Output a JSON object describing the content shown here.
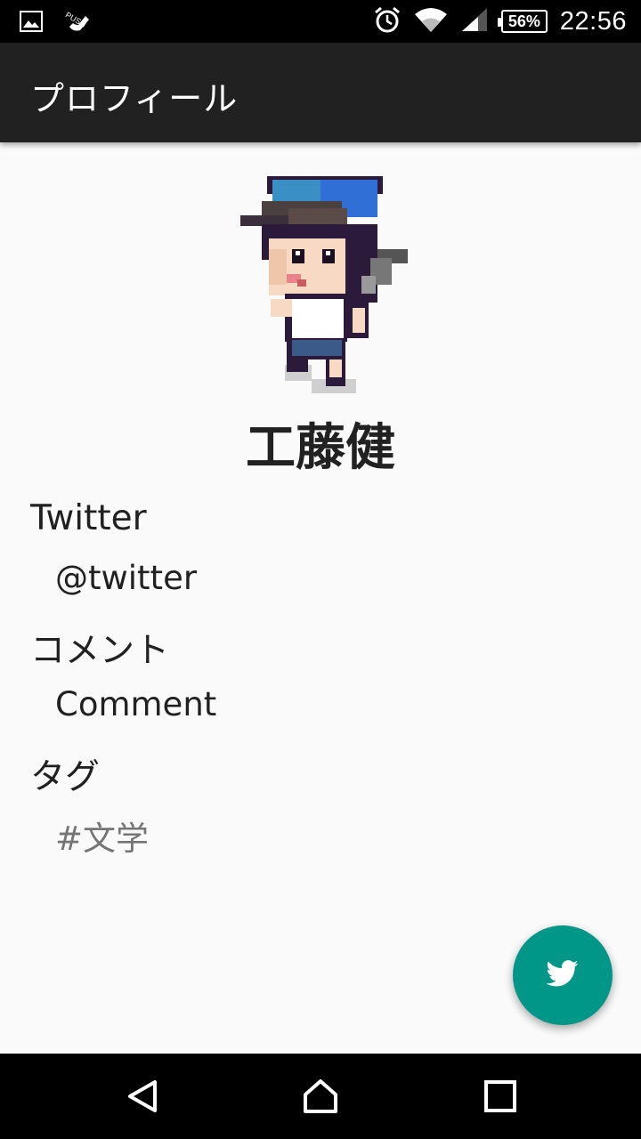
{
  "status_bar": {
    "time": "22:56",
    "battery_percent": "56%",
    "icons": [
      "image-icon",
      "push-notification-icon",
      "alarm-icon",
      "wifi-icon",
      "cell-signal-icon",
      "battery-icon"
    ]
  },
  "app_bar": {
    "title": "プロフィール",
    "background": "#212121"
  },
  "profile": {
    "name": "工藤健",
    "sections": {
      "twitter": {
        "label": "Twitter",
        "value": "@twitter"
      },
      "comment": {
        "label": "コメント",
        "value": "Comment"
      },
      "tag": {
        "label": "タグ",
        "value": "#文学"
      }
    }
  },
  "fab": {
    "icon": "twitter-bird-icon",
    "color": "#009688"
  },
  "nav_bar": {
    "buttons": [
      "back-icon",
      "home-icon",
      "recents-icon"
    ]
  }
}
